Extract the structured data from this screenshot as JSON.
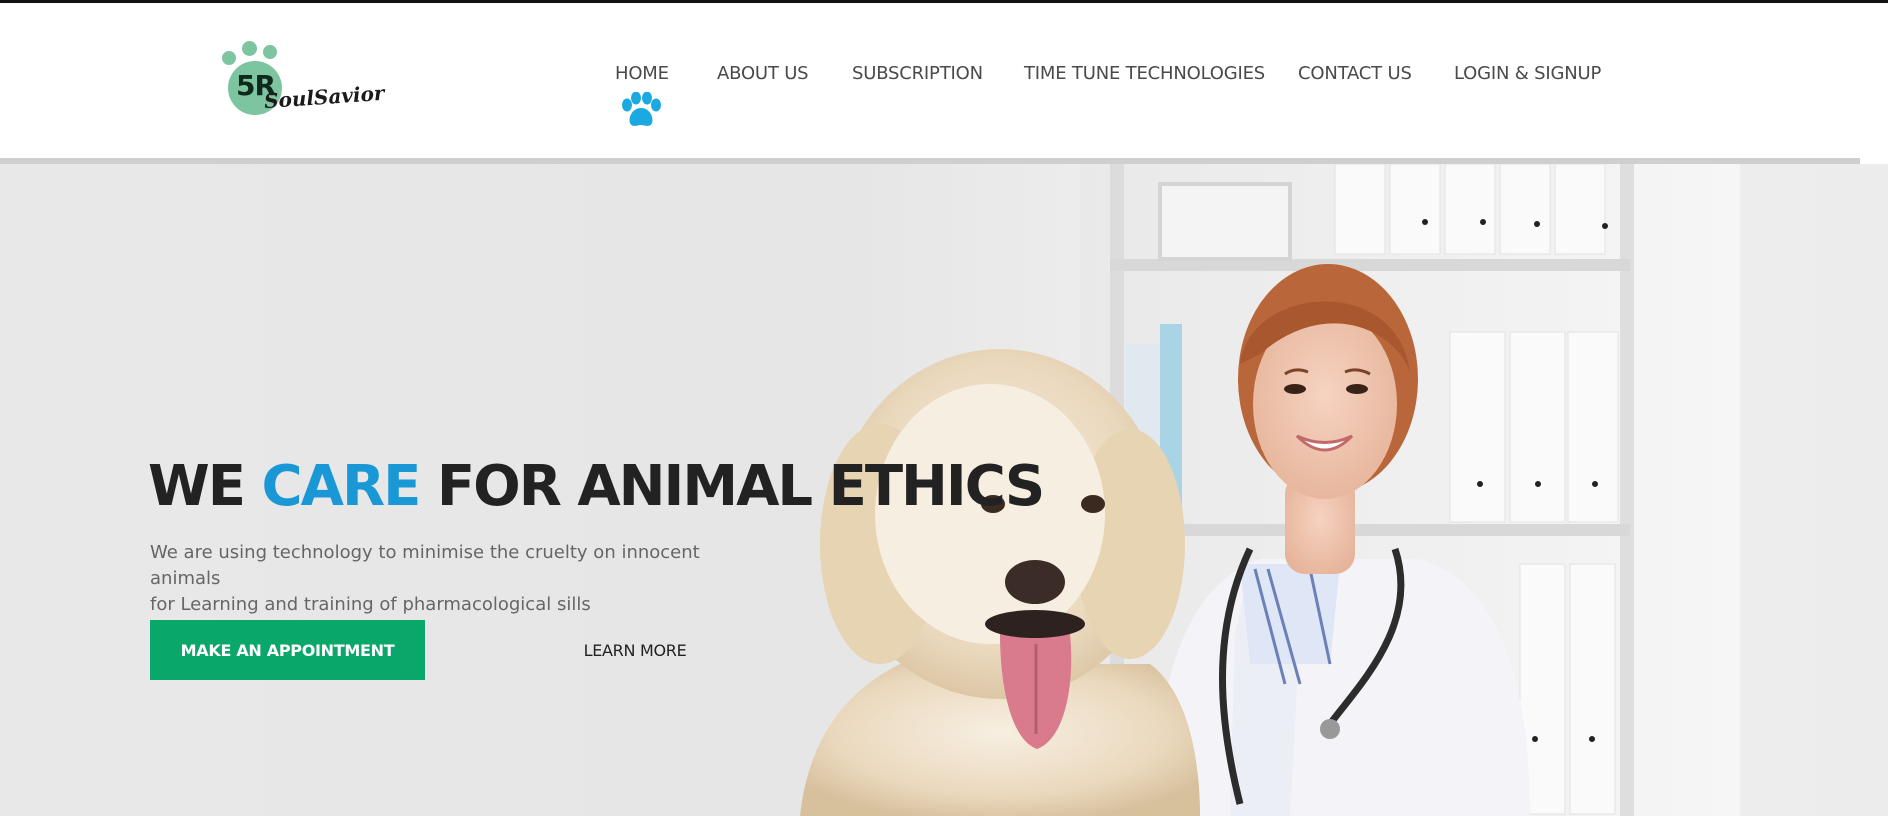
{
  "brand": {
    "logo_mark": "5R",
    "logo_script": "SoulSavior",
    "logo_color": "#7dc4a0"
  },
  "nav": {
    "items": [
      {
        "label": "HOME",
        "active": true
      },
      {
        "label": "ABOUT US"
      },
      {
        "label": "SUBSCRIPTION"
      },
      {
        "label": "TIME TUNE TECHNOLOGIES"
      },
      {
        "label": "CONTACT US"
      },
      {
        "label": "LOGIN & SIGNUP"
      }
    ],
    "active_indicator_icon": "paw-icon",
    "active_indicator_color": "#1aa9e1"
  },
  "hero": {
    "headline_part1": "WE ",
    "headline_accent": "CARE",
    "headline_part2": " FOR ANIMAL ETHICS",
    "accent_color": "#1a98d5",
    "subtext_line1": "We are using technology to minimise the cruelty on innocent animals",
    "subtext_line2": "for Learning and training of pharmacological sills",
    "primary_button": "MAKE AN APPOINTMENT",
    "primary_button_color": "#0aa76a",
    "secondary_button": "LEARN MORE"
  }
}
